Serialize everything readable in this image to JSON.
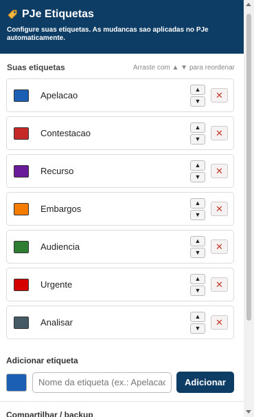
{
  "header": {
    "title": "PJe Etiquetas",
    "subtitle": "Configure suas etiquetas. As mudancas sao aplicadas no PJe automaticamente.",
    "icon": "tag-icon",
    "bg_color": "#0d3d64"
  },
  "list": {
    "heading": "Suas etiquetas",
    "hint": "Arraste com ▲ ▼ para reordenar",
    "up_label": "▲",
    "down_label": "▼",
    "delete_label": "✕",
    "items": [
      {
        "label": "Apelacao",
        "color": "#1a5fb4"
      },
      {
        "label": "Contestacao",
        "color": "#c62828"
      },
      {
        "label": "Recurso",
        "color": "#6a1b9a"
      },
      {
        "label": "Embargos",
        "color": "#f57c00"
      },
      {
        "label": "Audiencia",
        "color": "#2e7d32"
      },
      {
        "label": "Urgente",
        "color": "#d50000"
      },
      {
        "label": "Analisar",
        "color": "#455a64"
      }
    ]
  },
  "add": {
    "heading": "Adicionar etiqueta",
    "color": "#1a5fb4",
    "placeholder": "Nome da etiqueta (ex.: Apelacao)",
    "button_label": "Adicionar"
  },
  "share": {
    "heading": "Compartilhar / backup"
  }
}
